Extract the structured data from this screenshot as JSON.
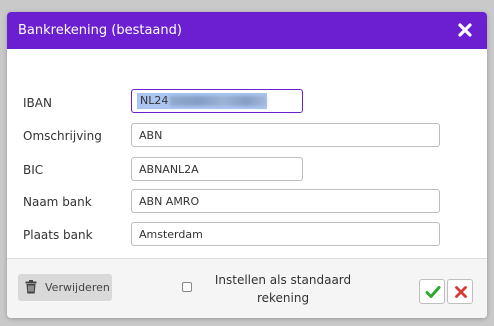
{
  "dialog": {
    "title": "Bankrekening (bestaand)",
    "close_icon": "close-icon"
  },
  "form": {
    "iban": {
      "label": "IBAN",
      "value": "NL24"
    },
    "omschrijving": {
      "label": "Omschrijving",
      "value": "ABN"
    },
    "bic": {
      "label": "BIC",
      "value": "ABNANL2A"
    },
    "naam_bank": {
      "label": "Naam bank",
      "value": "ABN AMRO"
    },
    "plaats_bank": {
      "label": "Plaats bank",
      "value": "Amsterdam"
    }
  },
  "footer": {
    "delete_label": "Verwijderen",
    "delete_icon": "trash-icon",
    "default_label_line1": "Instellen als standaard",
    "default_label_line2": "rekening",
    "default_checked": false,
    "confirm_icon": "check-icon",
    "cancel_icon": "close-icon"
  },
  "colors": {
    "titlebar": "#6b1fd1",
    "confirm": "#2eaa2e",
    "cancel": "#d63b3b",
    "overlay": "#c9c9c9"
  }
}
